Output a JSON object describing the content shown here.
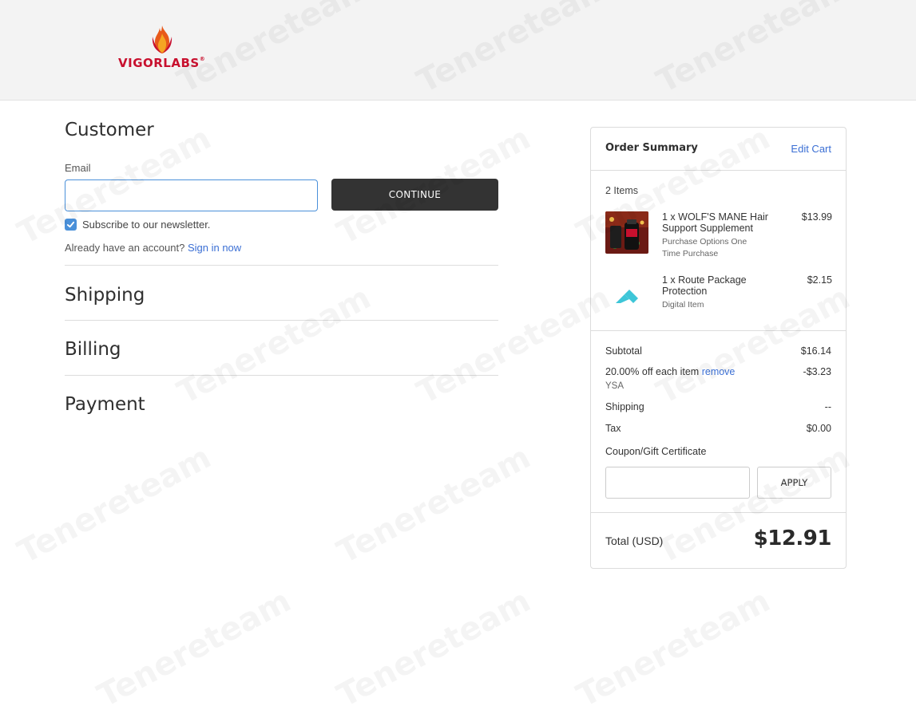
{
  "brand": {
    "logo_text": "VIGORLABS",
    "registered_mark": "®"
  },
  "customer": {
    "title": "Customer",
    "email_label": "Email",
    "email_value": "",
    "continue_label": "CONTINUE",
    "newsletter_label": "Subscribe to our newsletter.",
    "newsletter_checked": true,
    "account_prompt": "Already have an account?",
    "sign_in_label": "Sign in now"
  },
  "sections": {
    "shipping": "Shipping",
    "billing": "Billing",
    "payment": "Payment"
  },
  "summary": {
    "title": "Order Summary",
    "edit_cart": "Edit Cart",
    "items_count": "2 Items",
    "items": [
      {
        "name": "1 x WOLF'S MANE Hair Support Supplement",
        "sub1": "Purchase Options One",
        "sub2": "Time Purchase",
        "price": "$13.99",
        "icon": "product-thumbnail"
      },
      {
        "name": "1 x Route Package Protection",
        "sub1": "Digital Item",
        "price": "$2.15",
        "icon": "route-logo-icon"
      }
    ],
    "subtotal_label": "Subtotal",
    "subtotal_value": "$16.14",
    "discount_label": "20.00% off each item",
    "discount_remove": "remove",
    "discount_code": "YSA",
    "discount_value": "-$3.23",
    "shipping_label": "Shipping",
    "shipping_value": "--",
    "tax_label": "Tax",
    "tax_value": "$0.00",
    "coupon_label": "Coupon/Gift Certificate",
    "coupon_value": "",
    "apply_label": "APPLY",
    "total_label": "Total (USD)",
    "total_value": "$12.91"
  },
  "watermark_text": "Tenereteam",
  "colors": {
    "accent": "#4a90d9",
    "link": "#3b6fd4",
    "button_dark": "#333333",
    "brand_red": "#c8102e",
    "route_teal": "#3ec6d8"
  }
}
